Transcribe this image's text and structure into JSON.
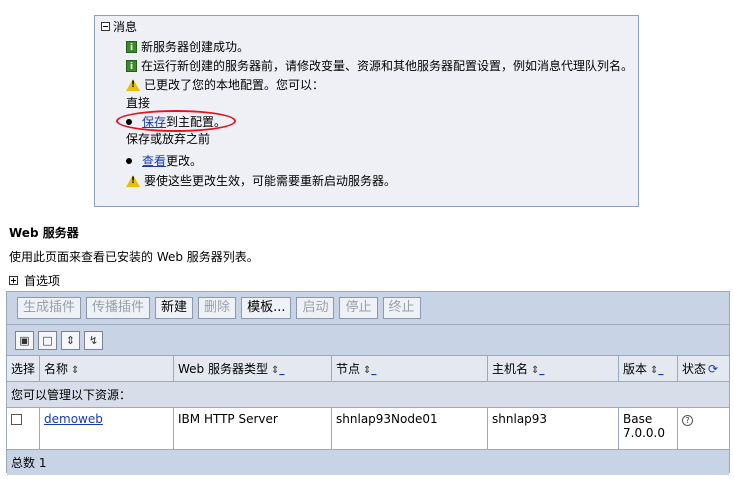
{
  "messages": {
    "header": "消息",
    "info1": "新服务器创建成功。",
    "info2": "在运行新创建的服务器前，请修改变量、资源和其他服务器配置设置，例如消息代理队列名。",
    "warn1": "已更改了您的本地配置。您可以：",
    "direct_label": "直接",
    "save_link": "保存",
    "save_rest": "到主配置。",
    "save_or_discard_label": "保存或放弃之前",
    "review_link": "查看",
    "review_rest": "更改。",
    "warn2": "要使这些更改生效，可能需要重新启动服务器。"
  },
  "page": {
    "title": "Web 服务器",
    "description": "使用此页面来查看已安装的 Web 服务器列表。",
    "preferences": "首选项"
  },
  "buttons": [
    {
      "label": "生成插件",
      "enabled": false
    },
    {
      "label": "传播插件",
      "enabled": false
    },
    {
      "label": "新建",
      "enabled": true
    },
    {
      "label": "删除",
      "enabled": false
    },
    {
      "label": "模板...",
      "enabled": true
    },
    {
      "label": "启动",
      "enabled": false
    },
    {
      "label": "停止",
      "enabled": false
    },
    {
      "label": "终止",
      "enabled": false
    }
  ],
  "toolbar_icons": [
    "select-all-icon",
    "deselect-all-icon",
    "show-filter-icon",
    "clear-filter-icon"
  ],
  "table": {
    "headers": {
      "select": "选择",
      "name": "名称",
      "type": "Web 服务器类型",
      "node": "节点",
      "host": "主机名",
      "version": "版本",
      "status": "状态"
    },
    "sort_marker": "_",
    "manage_label": "您可以管理以下资源：",
    "rows": [
      {
        "name": "demoweb",
        "type": "IBM HTTP Server",
        "node": "shnlap93Node01",
        "host": "shnlap93",
        "version_line1": "Base",
        "version_line2": "7.0.0.0"
      }
    ],
    "total": "总数 1"
  }
}
